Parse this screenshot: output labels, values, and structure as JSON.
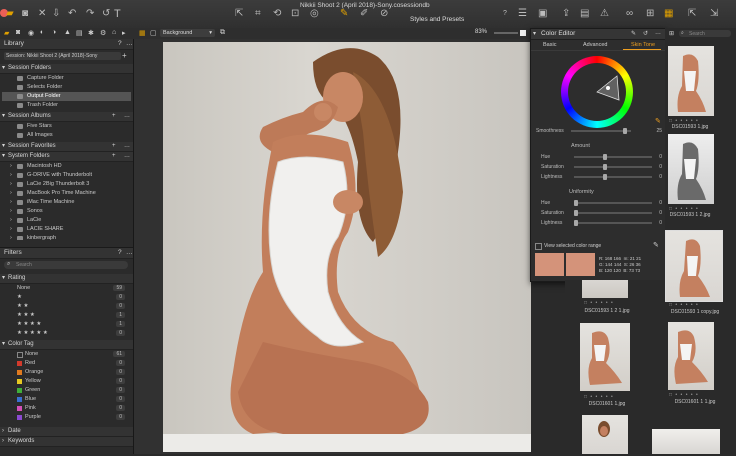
{
  "window": {
    "title": "Nikkii Shoot 2 (April 2018)-Sony.cosessiondb"
  },
  "toolbar": {
    "zoom": "83%",
    "panel_title": "Styles and Presets",
    "style_select": "Background"
  },
  "library": {
    "title": "Library",
    "session_select": "Session: Nikkii Shoot 2 (April 2018)-Sony",
    "session_folders_header": "Session Folders",
    "session_folders": [
      "Capture Folder",
      "Selects Folder",
      "Output Folder",
      "Trash Folder"
    ],
    "session_albums_header": "Session Albums",
    "session_albums": [
      "Five Stars",
      "All Images"
    ],
    "session_favorites_header": "Session Favorites",
    "system_folders_header": "System Folders",
    "system_folders": [
      "Macintosh HD",
      "G-DRIVE with Thunderbolt",
      "LaCie 2Big Thunderbolt 3",
      "MacBook Pro Time Machine",
      "iMac Time Machine",
      "Sonos",
      "LaCie",
      "LACIE SHARE",
      "kinbergraph"
    ]
  },
  "filters": {
    "title": "Filters",
    "search_placeholder": "Search",
    "rating_header": "Rating",
    "ratings": [
      {
        "label": "None",
        "count": "59"
      },
      {
        "label": "★",
        "count": "0"
      },
      {
        "label": "★ ★",
        "count": "0"
      },
      {
        "label": "★ ★ ★",
        "count": "1"
      },
      {
        "label": "★ ★ ★ ★",
        "count": "1"
      },
      {
        "label": "★ ★ ★ ★ ★",
        "count": "0"
      }
    ],
    "color_tag_header": "Color Tag",
    "color_tags": [
      {
        "label": "None",
        "count": "61",
        "color": "#2b2b2b"
      },
      {
        "label": "Red",
        "count": "0",
        "color": "#d33a2c"
      },
      {
        "label": "Orange",
        "count": "0",
        "color": "#e07a1f"
      },
      {
        "label": "Yellow",
        "count": "0",
        "color": "#e6c822"
      },
      {
        "label": "Green",
        "count": "0",
        "color": "#3fae3a"
      },
      {
        "label": "Blue",
        "count": "0",
        "color": "#3a6fd0"
      },
      {
        "label": "Pink",
        "count": "0",
        "color": "#d34fb8"
      },
      {
        "label": "Purple",
        "count": "0",
        "color": "#8a4ad0"
      }
    ],
    "date_header": "Date",
    "keywords_header": "Keywords"
  },
  "color_editor": {
    "title": "Color Editor",
    "tabs": [
      "Basic",
      "Advanced",
      "Skin Tone"
    ],
    "smoothness_label": "Smoothness",
    "smoothness_value": "25",
    "amount_header": "Amount",
    "amount": [
      {
        "label": "Hue",
        "value": "0"
      },
      {
        "label": "Saturation",
        "value": "0"
      },
      {
        "label": "Lightness",
        "value": "0"
      }
    ],
    "uniformity_header": "Uniformity",
    "uniformity": [
      {
        "label": "Hue",
        "value": "0"
      },
      {
        "label": "Saturation",
        "value": "0"
      },
      {
        "label": "Lightness",
        "value": "0"
      }
    ],
    "view_range_label": "View selected color range",
    "swatch_color": "#d4937a",
    "readout": {
      "r": [
        "R:",
        "168",
        "166",
        "m:",
        "21",
        "21"
      ],
      "g": [
        "G:",
        "144",
        "144",
        "S:",
        "26",
        "36"
      ],
      "b": [
        "B:",
        "120",
        "120",
        "B:",
        "73",
        "73"
      ]
    }
  },
  "browser": {
    "search_placeholder": "Search",
    "thumbnails": [
      "DSC01593 1.jpg",
      "DSC01593 1 2.jpg",
      "DSC01593 1 2 1.jpg",
      "DSC01593 1 copy.jpg",
      "DSC01601 1.jpg",
      "DSC01601 1 1.jpg"
    ]
  }
}
